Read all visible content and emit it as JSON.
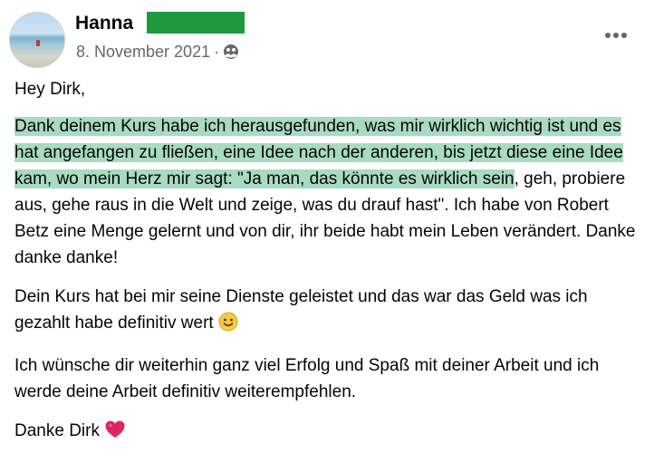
{
  "post": {
    "author": "Hanna",
    "date": "8. November 2021",
    "separator": "·",
    "audience_icon": "friends-icon",
    "more_icon": "more-options-icon",
    "greeting": "Hey Dirk,",
    "p1_highlight": "Dank deinem Kurs habe ich herausgefunden, was mir wirklich wichtig ist und es hat angefangen zu fließen, eine Idee nach der anderen, bis jetzt diese eine Idee kam, wo mein Herz mir sagt: \"Ja man, das könnte es wirklich sein",
    "p1_rest": ", geh, probiere aus, gehe raus in die Welt und zeige, was du drauf hast\". Ich habe von Robert Betz eine Menge gelernt und von dir, ihr beide habt mein Leben verändert. Danke danke danke!",
    "p2": "Dein Kurs hat bei mir seine Dienste geleistet und das war das Geld was ich gezahlt habe definitiv wert",
    "p3": "Ich wünsche dir weiterhin ganz viel Erfolg und Spaß mit deiner Arbeit und ich werde deine Arbeit definitiv weiterempfehlen.",
    "closing": "Danke Dirk",
    "emoji_smile": "slightly-smiling-face",
    "emoji_heart": "red-heart"
  },
  "colors": {
    "highlight": "#a8dbbf",
    "name_redaction": "#1e9a3d",
    "meta_text": "#65676b"
  }
}
